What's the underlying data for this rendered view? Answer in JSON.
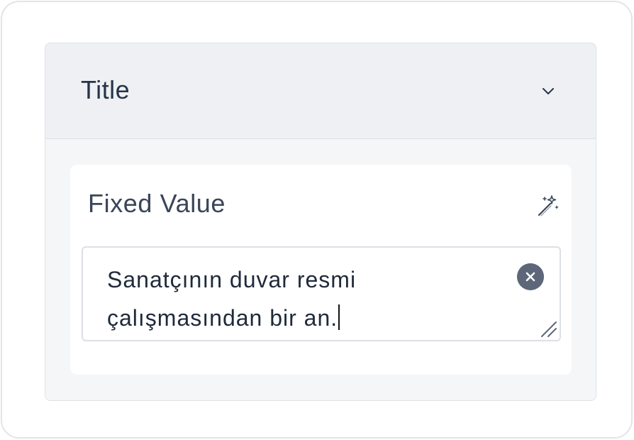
{
  "panel": {
    "title": "Title",
    "expand_icon": "chevron-down-icon"
  },
  "field": {
    "label": "Fixed Value",
    "action_icon": "magic-wand-icon",
    "value": "Sanatçının duvar resmi\nçalışmasından bir an.",
    "clear_icon": "close-circle-icon",
    "resize_icon": "resize-handle-icon"
  },
  "colors": {
    "header_bg": "#eef0f3",
    "panel_bg": "#f5f6f8",
    "text_primary": "#27344a",
    "clear_button": "#5d6779"
  }
}
